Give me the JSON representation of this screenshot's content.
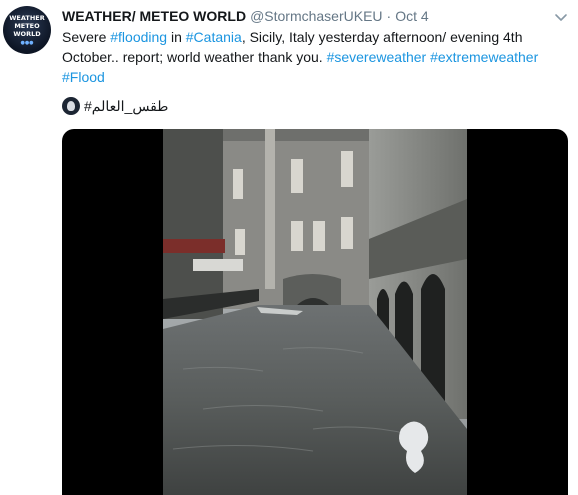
{
  "tweet": {
    "avatar_text": [
      "WEATHER",
      "METEO",
      "WORLD"
    ],
    "display_name": "WEATHER/ METEO WORLD",
    "handle": "@StormchaserUKEU",
    "separator": "·",
    "date": "Oct 4",
    "text_parts": {
      "p1": "Severe ",
      "t1": "#flooding",
      "p2": " in ",
      "t2": "#Catania",
      "p3": ", Sicily, Italy yesterday afternoon/ evening 4th October.. report; world weather thank you. ",
      "t3": "#severeweather",
      "p4": " ",
      "t4": "#extremeweather",
      "p5": " ",
      "t5": "#Flood"
    },
    "arabic_hashtag": "طقس_العالم#"
  },
  "icons": {
    "caret": "chevron-down-icon",
    "avatar": "weather-logo",
    "media": "video-thumbnail"
  },
  "colors": {
    "link": "#1b95e0",
    "text": "#14171a",
    "muted": "#657786",
    "video_bg": "#000000"
  }
}
